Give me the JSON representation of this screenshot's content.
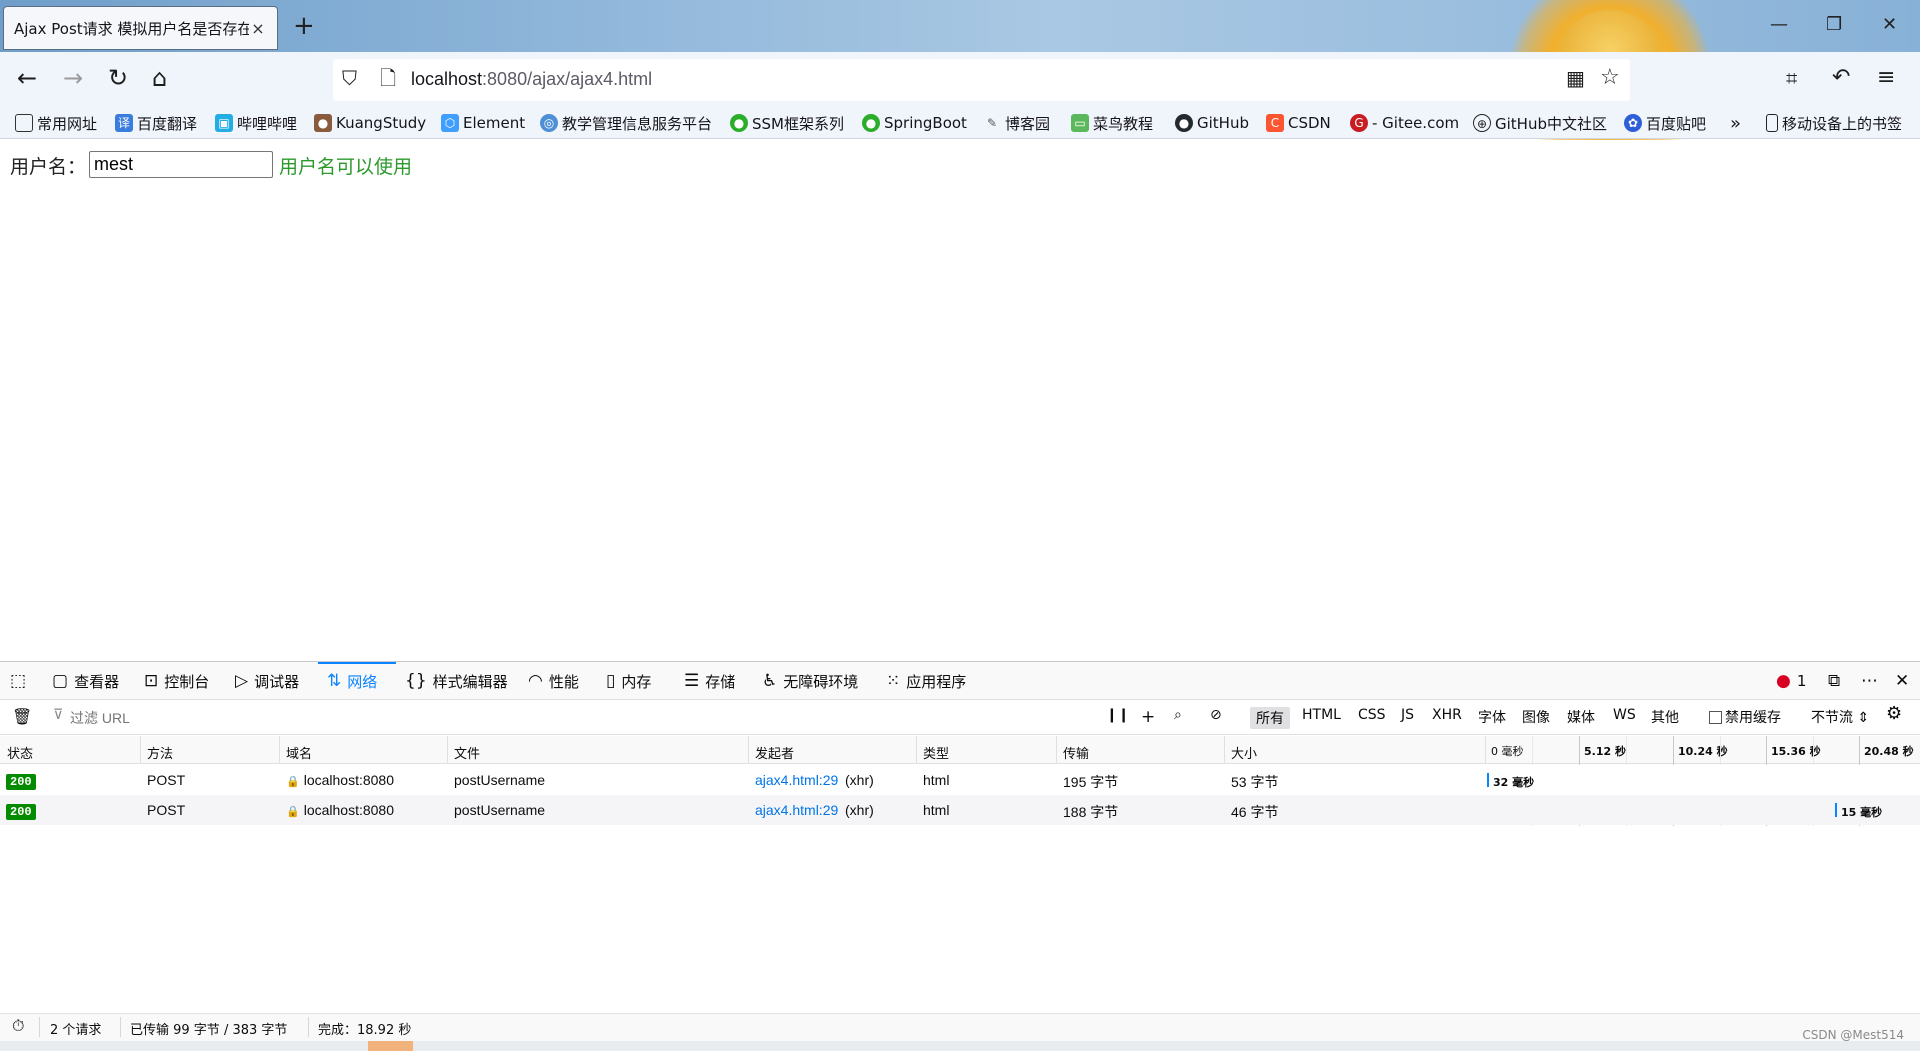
{
  "browser": {
    "tab_title": "Ajax Post请求 模拟用户名是否存在",
    "tab_close": "×",
    "new_tab": "+",
    "url_host": "localhost",
    "url_rest": ":8080/ajax/ajax4.html"
  },
  "bookmarks": [
    "常用网址",
    "百度翻译",
    "哔哩哔哩",
    "KuangStudy",
    "Element",
    "教学管理信息服务平台",
    "SSM框架系列",
    "SpringBoot",
    "博客园",
    "菜鸟教程",
    "GitHub",
    "CSDN",
    "- Gitee.com",
    "GitHub中文社区",
    "百度贴吧",
    "移动设备上的书签"
  ],
  "page": {
    "label": "用户名：",
    "input_value": "mest",
    "message": "用户名可以使用"
  },
  "devtools": {
    "tabs": [
      "查看器",
      "控制台",
      "调试器",
      "网络",
      "样式编辑器",
      "性能",
      "内存",
      "存储",
      "无障碍环境",
      "应用程序"
    ],
    "error_count": "1",
    "filter_placeholder": "过滤 URL",
    "filter_types": [
      "所有",
      "HTML",
      "CSS",
      "JS",
      "XHR",
      "字体",
      "图像",
      "媒体",
      "WS",
      "其他"
    ],
    "disable_cache": "禁用缓存",
    "throttle": "不节流 ⇕",
    "columns": [
      "状态",
      "方法",
      "域名",
      "文件",
      "发起者",
      "类型",
      "传输",
      "大小"
    ],
    "timeline": [
      "0 毫秒",
      "5.12 秒",
      "10.24 秒",
      "15.36 秒",
      "20.48 秒"
    ],
    "rows": [
      {
        "status": "200",
        "method": "POST",
        "domain": "localhost:8080",
        "file": "postUsername",
        "initiator_link": "ajax4.html:29",
        "initiator_type": "(xhr)",
        "type": "html",
        "transfer": "195 字节",
        "size": "53 字节",
        "timing": "32 毫秒",
        "timing_fraction": 0.0
      },
      {
        "status": "200",
        "method": "POST",
        "domain": "localhost:8080",
        "file": "postUsername",
        "initiator_link": "ajax4.html:29",
        "initiator_type": "(xhr)",
        "type": "html",
        "transfer": "188 字节",
        "size": "46 字节",
        "timing": "15 毫秒",
        "timing_fraction": 0.87
      }
    ],
    "status_bar": {
      "requests": "2 个请求",
      "transferred": "已传输 99 字节 / 383 字节",
      "finished": "完成：18.92 秒"
    }
  },
  "watermark": "CSDN @Mest514"
}
